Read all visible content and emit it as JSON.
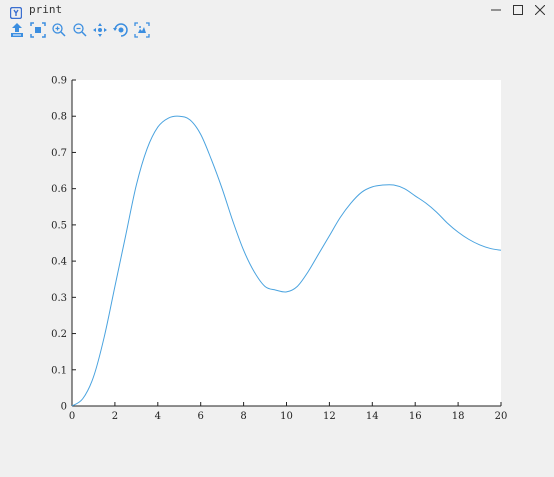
{
  "window": {
    "title": "print",
    "icons": {
      "app": "app-logo-icon",
      "minimize": "minimize-icon",
      "maximize": "maximize-icon",
      "close": "close-icon"
    }
  },
  "toolbar": {
    "tools": [
      {
        "name": "save-icon"
      },
      {
        "name": "select-region-icon"
      },
      {
        "name": "zoom-in-icon"
      },
      {
        "name": "zoom-out-icon"
      },
      {
        "name": "pan-icon"
      },
      {
        "name": "rotate-view-icon"
      },
      {
        "name": "reset-view-icon"
      }
    ],
    "accent_color": "#3b8ee0"
  },
  "chart_data": {
    "type": "line",
    "title": "",
    "xlabel": "",
    "ylabel": "",
    "xlim": [
      0,
      20
    ],
    "ylim": [
      0,
      0.9
    ],
    "x_ticks": [
      "0",
      "2",
      "4",
      "6",
      "8",
      "10",
      "12",
      "14",
      "16",
      "18",
      "20"
    ],
    "y_ticks": [
      "0",
      "0.1",
      "0.2",
      "0.3",
      "0.4",
      "0.5",
      "0.6",
      "0.7",
      "0.8",
      "0.9"
    ],
    "grid": false,
    "line_color": "#4aa3df",
    "series": [
      {
        "x": [
          0,
          0.5,
          1,
          1.5,
          2,
          2.5,
          3,
          3.5,
          4,
          4.5,
          5,
          5.5,
          6,
          6.5,
          7,
          7.5,
          8,
          8.5,
          9,
          9.5,
          10,
          10.5,
          11,
          11.5,
          12,
          12.5,
          13,
          13.5,
          14,
          14.5,
          15,
          15.5,
          16,
          16.5,
          17,
          17.5,
          18,
          18.5,
          19,
          19.5,
          20
        ],
        "y": [
          0,
          0.02,
          0.08,
          0.19,
          0.33,
          0.47,
          0.61,
          0.71,
          0.77,
          0.795,
          0.8,
          0.79,
          0.75,
          0.68,
          0.6,
          0.51,
          0.43,
          0.37,
          0.33,
          0.32,
          0.315,
          0.33,
          0.37,
          0.42,
          0.47,
          0.52,
          0.56,
          0.59,
          0.605,
          0.61,
          0.61,
          0.6,
          0.58,
          0.56,
          0.535,
          0.505,
          0.48,
          0.46,
          0.445,
          0.435,
          0.43
        ]
      }
    ]
  }
}
